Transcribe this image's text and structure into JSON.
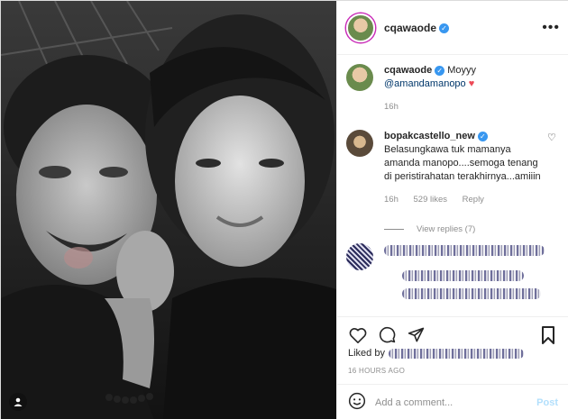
{
  "post": {
    "author": "cqawaode",
    "more_label": "•••"
  },
  "caption": {
    "username": "cqawaode",
    "text": "Moyyy",
    "mention": "@amandamanopo",
    "heart": "♥",
    "time": "16h"
  },
  "comment": {
    "username": "bopakcastello_new",
    "text": "Belasungkawa tuk mamanya amanda manopo....semoga tenang di peristirahatan terakhirnya...amiiin",
    "time": "16h",
    "likes": "529 likes",
    "reply": "Reply",
    "heart": "♡"
  },
  "view_replies": "View replies (7)",
  "liked_by_label": "Liked by",
  "timestamp": "16 HOURS AGO",
  "add_comment": {
    "placeholder": "Add a comment...",
    "post_label": "Post"
  },
  "verified_mark": "✓",
  "colors": {
    "link": "#00376b",
    "verified": "#3897f0",
    "heart": "#ed4956",
    "post_disabled": "#b2dffc",
    "muted": "#8e8e8e"
  },
  "icons": [
    "like-icon",
    "comment-icon",
    "share-icon",
    "save-icon",
    "emoji-icon",
    "tagged-user-icon"
  ]
}
